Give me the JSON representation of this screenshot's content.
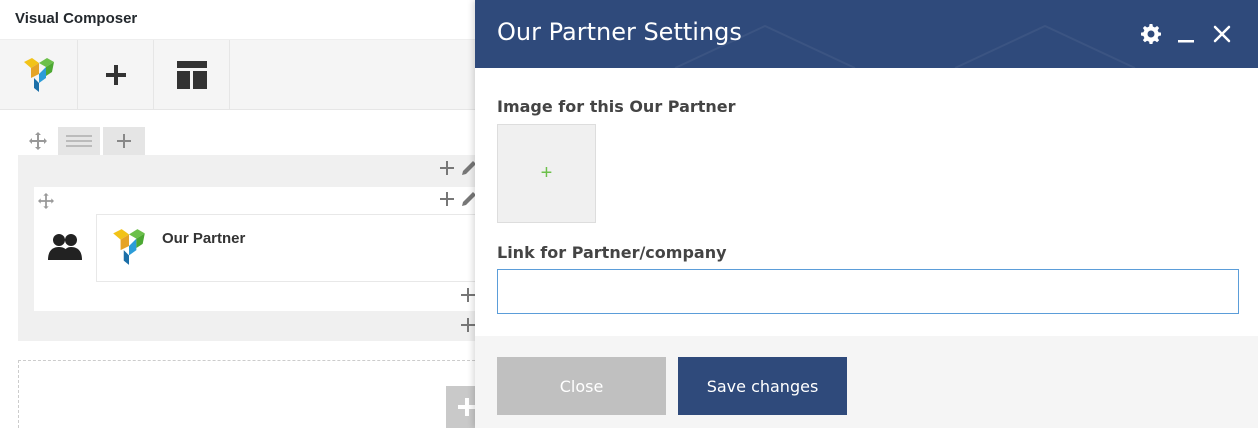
{
  "editor": {
    "title": "Visual Composer",
    "element_label": "Our Partner"
  },
  "modal": {
    "title": "Our Partner Settings",
    "image_label": "Image for this Our Partner",
    "image_add_glyph": "+",
    "link_label": "Link for Partner/company",
    "link_value": "",
    "close_label": "Close",
    "save_label": "Save changes"
  },
  "colors": {
    "modal_header": "#2f4a7b",
    "save_button": "#2f4a7b",
    "close_button": "#c0c0c0",
    "input_focus": "#5b9dd9",
    "add_glyph": "#6cc04a"
  },
  "icons": {
    "toolbar": [
      "vc-logo-icon",
      "plus-icon",
      "template-icon"
    ],
    "header": [
      "gear-icon",
      "minimize-icon",
      "close-icon"
    ],
    "element": [
      "partners-icon",
      "vc-logo-icon"
    ]
  }
}
